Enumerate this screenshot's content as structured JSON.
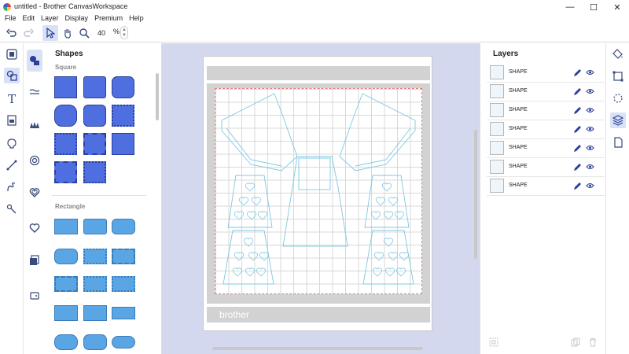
{
  "window": {
    "title": "untitled - Brother CanvasWorkspace",
    "minimize": "—",
    "maximize": "☐",
    "close": "✕"
  },
  "menu": [
    "File",
    "Edit",
    "Layer",
    "Display",
    "Premium",
    "Help"
  ],
  "toolbar": {
    "zoom_value": "40",
    "zoom_unit": "%"
  },
  "shapes_panel": {
    "title": "Shapes",
    "section_square": "Square",
    "section_rectangle": "Rectangle"
  },
  "mat": {
    "brand_label": "brother"
  },
  "layers_panel": {
    "title": "Layers",
    "items": [
      {
        "name": "SHAPE"
      },
      {
        "name": "SHAPE"
      },
      {
        "name": "SHAPE"
      },
      {
        "name": "SHAPE"
      },
      {
        "name": "SHAPE"
      },
      {
        "name": "SHAPE"
      },
      {
        "name": "SHAPE"
      }
    ]
  },
  "icons": {
    "undo": "undo-icon",
    "redo": "redo-icon",
    "select": "cursor-icon",
    "pan": "hand-icon",
    "zoom": "magnifier-icon",
    "edit": "pen-icon",
    "visibility": "eye-icon"
  },
  "colors": {
    "accent": "#2b3f9a",
    "shape_fill": "#4f6ee0",
    "rect_fill": "#5aa6e5",
    "canvas_bg": "#d3d8ef",
    "cut_line": "#7ec8e3"
  }
}
